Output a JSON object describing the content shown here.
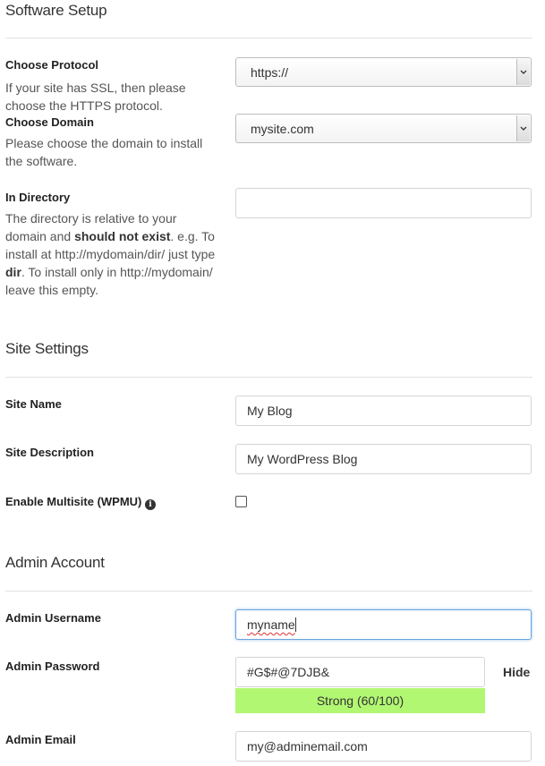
{
  "software_setup": {
    "title": "Software Setup",
    "protocol": {
      "label": "Choose Protocol",
      "desc": "If your site has SSL, then please choose the HTTPS protocol.",
      "value": "https://"
    },
    "domain": {
      "label": "Choose Domain",
      "desc": "Please choose the domain to install the software.",
      "value": "mysite.com"
    },
    "directory": {
      "label": "In Directory",
      "desc_1": "The directory is relative to your domain and ",
      "desc_bold_1": "should not exist",
      "desc_2": ". e.g. To install at http://mydomain/dir/ just type ",
      "desc_bold_2": "dir",
      "desc_3": ". To install only in http://mydomain/ leave this empty.",
      "value": ""
    }
  },
  "site_settings": {
    "title": "Site Settings",
    "site_name": {
      "label": "Site Name",
      "value": "My Blog"
    },
    "site_description": {
      "label": "Site Description",
      "value": "My WordPress Blog"
    },
    "multisite": {
      "label": "Enable Multisite (WPMU)",
      "info_icon": "info-icon",
      "checked": false
    }
  },
  "admin_account": {
    "title": "Admin Account",
    "username": {
      "label": "Admin Username",
      "value": "myname"
    },
    "password": {
      "label": "Admin Password",
      "value": "#G$#@7DJB&",
      "hide_label": "Hide",
      "strength_text": "Strong (60/100)",
      "strength_color": "#b2f772"
    },
    "email": {
      "label": "Admin Email",
      "value": "my@adminemail.com"
    }
  }
}
